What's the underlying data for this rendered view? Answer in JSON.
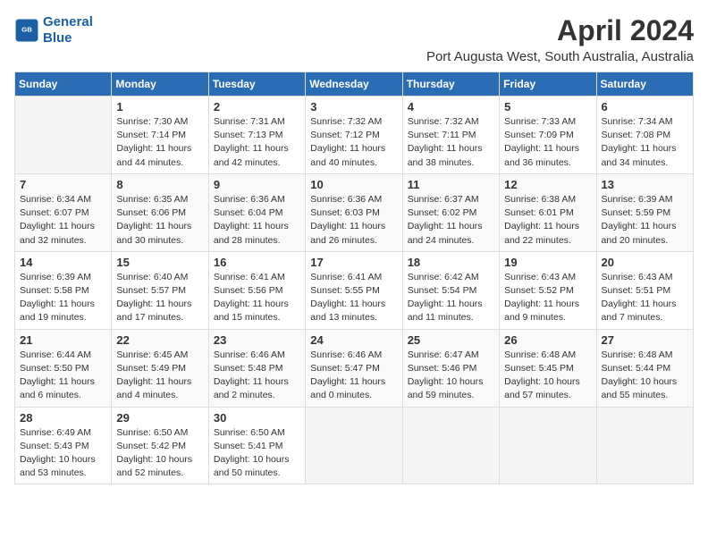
{
  "logo": {
    "line1": "General",
    "line2": "Blue"
  },
  "title": "April 2024",
  "subtitle": "Port Augusta West, South Australia, Australia",
  "weekdays": [
    "Sunday",
    "Monday",
    "Tuesday",
    "Wednesday",
    "Thursday",
    "Friday",
    "Saturday"
  ],
  "weeks": [
    [
      {
        "day": "",
        "info": ""
      },
      {
        "day": "1",
        "info": "Sunrise: 7:30 AM\nSunset: 7:14 PM\nDaylight: 11 hours\nand 44 minutes."
      },
      {
        "day": "2",
        "info": "Sunrise: 7:31 AM\nSunset: 7:13 PM\nDaylight: 11 hours\nand 42 minutes."
      },
      {
        "day": "3",
        "info": "Sunrise: 7:32 AM\nSunset: 7:12 PM\nDaylight: 11 hours\nand 40 minutes."
      },
      {
        "day": "4",
        "info": "Sunrise: 7:32 AM\nSunset: 7:11 PM\nDaylight: 11 hours\nand 38 minutes."
      },
      {
        "day": "5",
        "info": "Sunrise: 7:33 AM\nSunset: 7:09 PM\nDaylight: 11 hours\nand 36 minutes."
      },
      {
        "day": "6",
        "info": "Sunrise: 7:34 AM\nSunset: 7:08 PM\nDaylight: 11 hours\nand 34 minutes."
      }
    ],
    [
      {
        "day": "7",
        "info": "Sunrise: 6:34 AM\nSunset: 6:07 PM\nDaylight: 11 hours\nand 32 minutes."
      },
      {
        "day": "8",
        "info": "Sunrise: 6:35 AM\nSunset: 6:06 PM\nDaylight: 11 hours\nand 30 minutes."
      },
      {
        "day": "9",
        "info": "Sunrise: 6:36 AM\nSunset: 6:04 PM\nDaylight: 11 hours\nand 28 minutes."
      },
      {
        "day": "10",
        "info": "Sunrise: 6:36 AM\nSunset: 6:03 PM\nDaylight: 11 hours\nand 26 minutes."
      },
      {
        "day": "11",
        "info": "Sunrise: 6:37 AM\nSunset: 6:02 PM\nDaylight: 11 hours\nand 24 minutes."
      },
      {
        "day": "12",
        "info": "Sunrise: 6:38 AM\nSunset: 6:01 PM\nDaylight: 11 hours\nand 22 minutes."
      },
      {
        "day": "13",
        "info": "Sunrise: 6:39 AM\nSunset: 5:59 PM\nDaylight: 11 hours\nand 20 minutes."
      }
    ],
    [
      {
        "day": "14",
        "info": "Sunrise: 6:39 AM\nSunset: 5:58 PM\nDaylight: 11 hours\nand 19 minutes."
      },
      {
        "day": "15",
        "info": "Sunrise: 6:40 AM\nSunset: 5:57 PM\nDaylight: 11 hours\nand 17 minutes."
      },
      {
        "day": "16",
        "info": "Sunrise: 6:41 AM\nSunset: 5:56 PM\nDaylight: 11 hours\nand 15 minutes."
      },
      {
        "day": "17",
        "info": "Sunrise: 6:41 AM\nSunset: 5:55 PM\nDaylight: 11 hours\nand 13 minutes."
      },
      {
        "day": "18",
        "info": "Sunrise: 6:42 AM\nSunset: 5:54 PM\nDaylight: 11 hours\nand 11 minutes."
      },
      {
        "day": "19",
        "info": "Sunrise: 6:43 AM\nSunset: 5:52 PM\nDaylight: 11 hours\nand 9 minutes."
      },
      {
        "day": "20",
        "info": "Sunrise: 6:43 AM\nSunset: 5:51 PM\nDaylight: 11 hours\nand 7 minutes."
      }
    ],
    [
      {
        "day": "21",
        "info": "Sunrise: 6:44 AM\nSunset: 5:50 PM\nDaylight: 11 hours\nand 6 minutes."
      },
      {
        "day": "22",
        "info": "Sunrise: 6:45 AM\nSunset: 5:49 PM\nDaylight: 11 hours\nand 4 minutes."
      },
      {
        "day": "23",
        "info": "Sunrise: 6:46 AM\nSunset: 5:48 PM\nDaylight: 11 hours\nand 2 minutes."
      },
      {
        "day": "24",
        "info": "Sunrise: 6:46 AM\nSunset: 5:47 PM\nDaylight: 11 hours\nand 0 minutes."
      },
      {
        "day": "25",
        "info": "Sunrise: 6:47 AM\nSunset: 5:46 PM\nDaylight: 10 hours\nand 59 minutes."
      },
      {
        "day": "26",
        "info": "Sunrise: 6:48 AM\nSunset: 5:45 PM\nDaylight: 10 hours\nand 57 minutes."
      },
      {
        "day": "27",
        "info": "Sunrise: 6:48 AM\nSunset: 5:44 PM\nDaylight: 10 hours\nand 55 minutes."
      }
    ],
    [
      {
        "day": "28",
        "info": "Sunrise: 6:49 AM\nSunset: 5:43 PM\nDaylight: 10 hours\nand 53 minutes."
      },
      {
        "day": "29",
        "info": "Sunrise: 6:50 AM\nSunset: 5:42 PM\nDaylight: 10 hours\nand 52 minutes."
      },
      {
        "day": "30",
        "info": "Sunrise: 6:50 AM\nSunset: 5:41 PM\nDaylight: 10 hours\nand 50 minutes."
      },
      {
        "day": "",
        "info": ""
      },
      {
        "day": "",
        "info": ""
      },
      {
        "day": "",
        "info": ""
      },
      {
        "day": "",
        "info": ""
      }
    ]
  ]
}
